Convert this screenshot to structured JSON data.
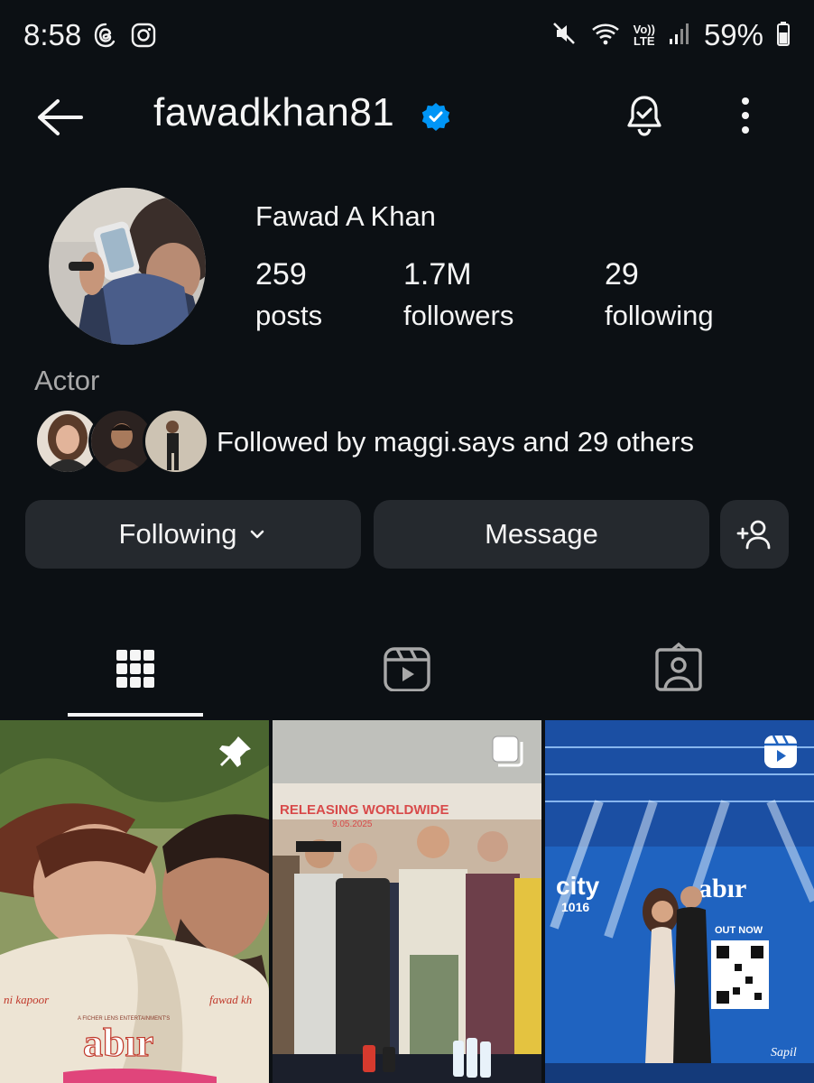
{
  "status_bar": {
    "time": "8:58",
    "network_badge_top": "Vo))",
    "network_badge_bottom": "LTE",
    "battery_percent": "59%"
  },
  "header": {
    "username": "fawadkhan81",
    "verified": true
  },
  "profile": {
    "display_name": "Fawad A Khan",
    "posts_count": "259",
    "posts_label": "posts",
    "followers_count": "1.7M",
    "followers_label": "followers",
    "following_count": "29",
    "following_label": "following",
    "category": "Actor",
    "followed_by_text": "Followed by maggi.says and 29 others"
  },
  "actions": {
    "following_label": "Following",
    "message_label": "Message"
  },
  "tabs": [
    {
      "name": "posts-grid",
      "icon": "grid-icon",
      "active": true
    },
    {
      "name": "reels",
      "icon": "reels-icon",
      "active": false
    },
    {
      "name": "tagged",
      "icon": "tagged-person-icon",
      "active": false
    }
  ],
  "posts": [
    {
      "overlay_text_left": "ni kapoor",
      "overlay_text_right": "fawad kh",
      "overlay_small": "A FICHER LENS ENTERTAINMENT'S",
      "title": "abır",
      "badge": "pin-icon"
    },
    {
      "banner_title": "RELEASING WORLDWIDE",
      "banner_date": "9.05.2025",
      "badge": "carousel-icon"
    },
    {
      "brand_left": "city",
      "brand_left_sub": "1016",
      "title": "abır",
      "qr_label": "OUT NOW",
      "signature": "Sapil",
      "badge": "reels-icon"
    }
  ],
  "colors": {
    "background": "#0c1014",
    "button_bg": "#25292e",
    "verified_blue": "#0095f6",
    "secondary_text": "#a8a8a8"
  }
}
